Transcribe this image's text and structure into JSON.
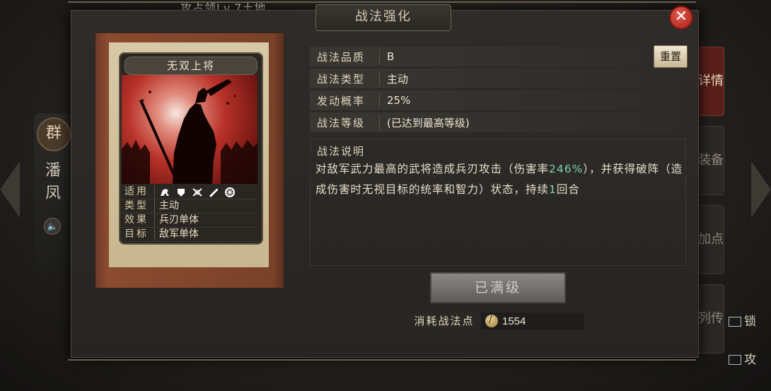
{
  "background": {
    "top_title": "攻占领Lv.7土地",
    "side_emblem": "群",
    "side_name": "潘凤",
    "right_tabs": [
      "详情",
      "装备",
      "加点",
      "列传"
    ],
    "lock_label": "锁",
    "attack_label": "攻"
  },
  "modal": {
    "title": "战法强化",
    "close": "✕"
  },
  "card": {
    "name": "无双上将",
    "applicable_label": "适用",
    "applicable_icons": [
      "cavalry-icon",
      "shield-icon",
      "crossed-bows-icon",
      "spear-icon",
      "wheel-icon"
    ],
    "type_label": "类型",
    "type_value": "主动",
    "effect_label": "效果",
    "effect_value": "兵刃单体",
    "target_label": "目标",
    "target_value": "敌军单体"
  },
  "info": {
    "quality_label": "战法品质",
    "quality_value": "B",
    "type_label": "战法类型",
    "type_value": "主动",
    "rate_label": "发动概率",
    "rate_value": "25%",
    "level_label": "战法等级",
    "level_value": "(已达到最高等级)",
    "reset_label": "重置"
  },
  "description": {
    "title": "战法说明",
    "text_1": "对敌军武力最高的武将造成兵刃攻击（伤害率",
    "highlight_1": "246%",
    "text_2": "），并获得破阵（造成伤害时无视目标的统率和智力）状态，持续",
    "highlight_2": "1",
    "text_3": "回合"
  },
  "actions": {
    "max_level_label": "已满级",
    "cost_label": "消耗战法点",
    "cost_value": "1554"
  },
  "colors": {
    "highlight": "#7fd0a8",
    "close": "#c0392b",
    "active_tab": "#5a1f1a"
  }
}
